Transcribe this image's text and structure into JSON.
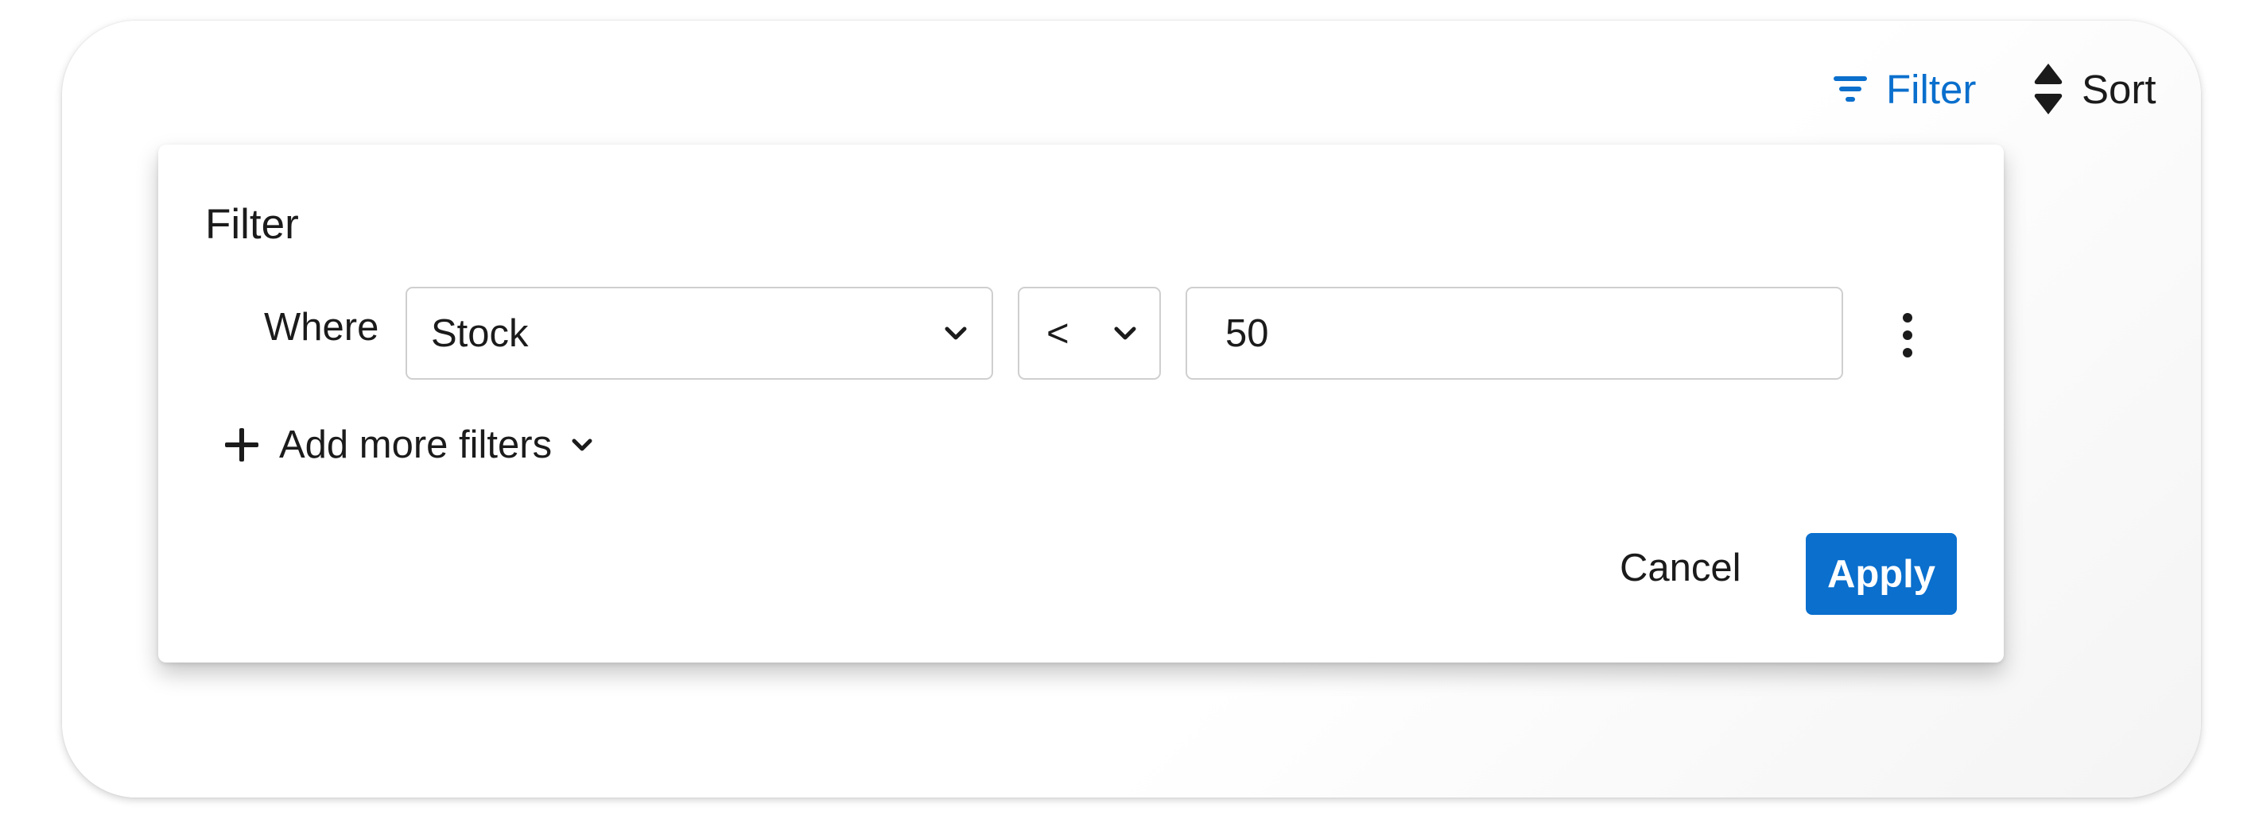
{
  "toolbar": {
    "filter_label": "Filter",
    "filter_icon": "filter-lines-icon",
    "sort_label": "Sort",
    "sort_icon": "sort-updown-icon"
  },
  "filter_popover": {
    "title": "Filter",
    "row": {
      "where_label": "Where",
      "field_value": "Stock",
      "operator_value": "<",
      "value": "50"
    },
    "add_more_label": "Add more filters",
    "cancel_label": "Cancel",
    "apply_label": "Apply"
  },
  "colors": {
    "accent": "#0a6fcd",
    "text": "#1b1b1b",
    "border": "#cfcfcf"
  }
}
